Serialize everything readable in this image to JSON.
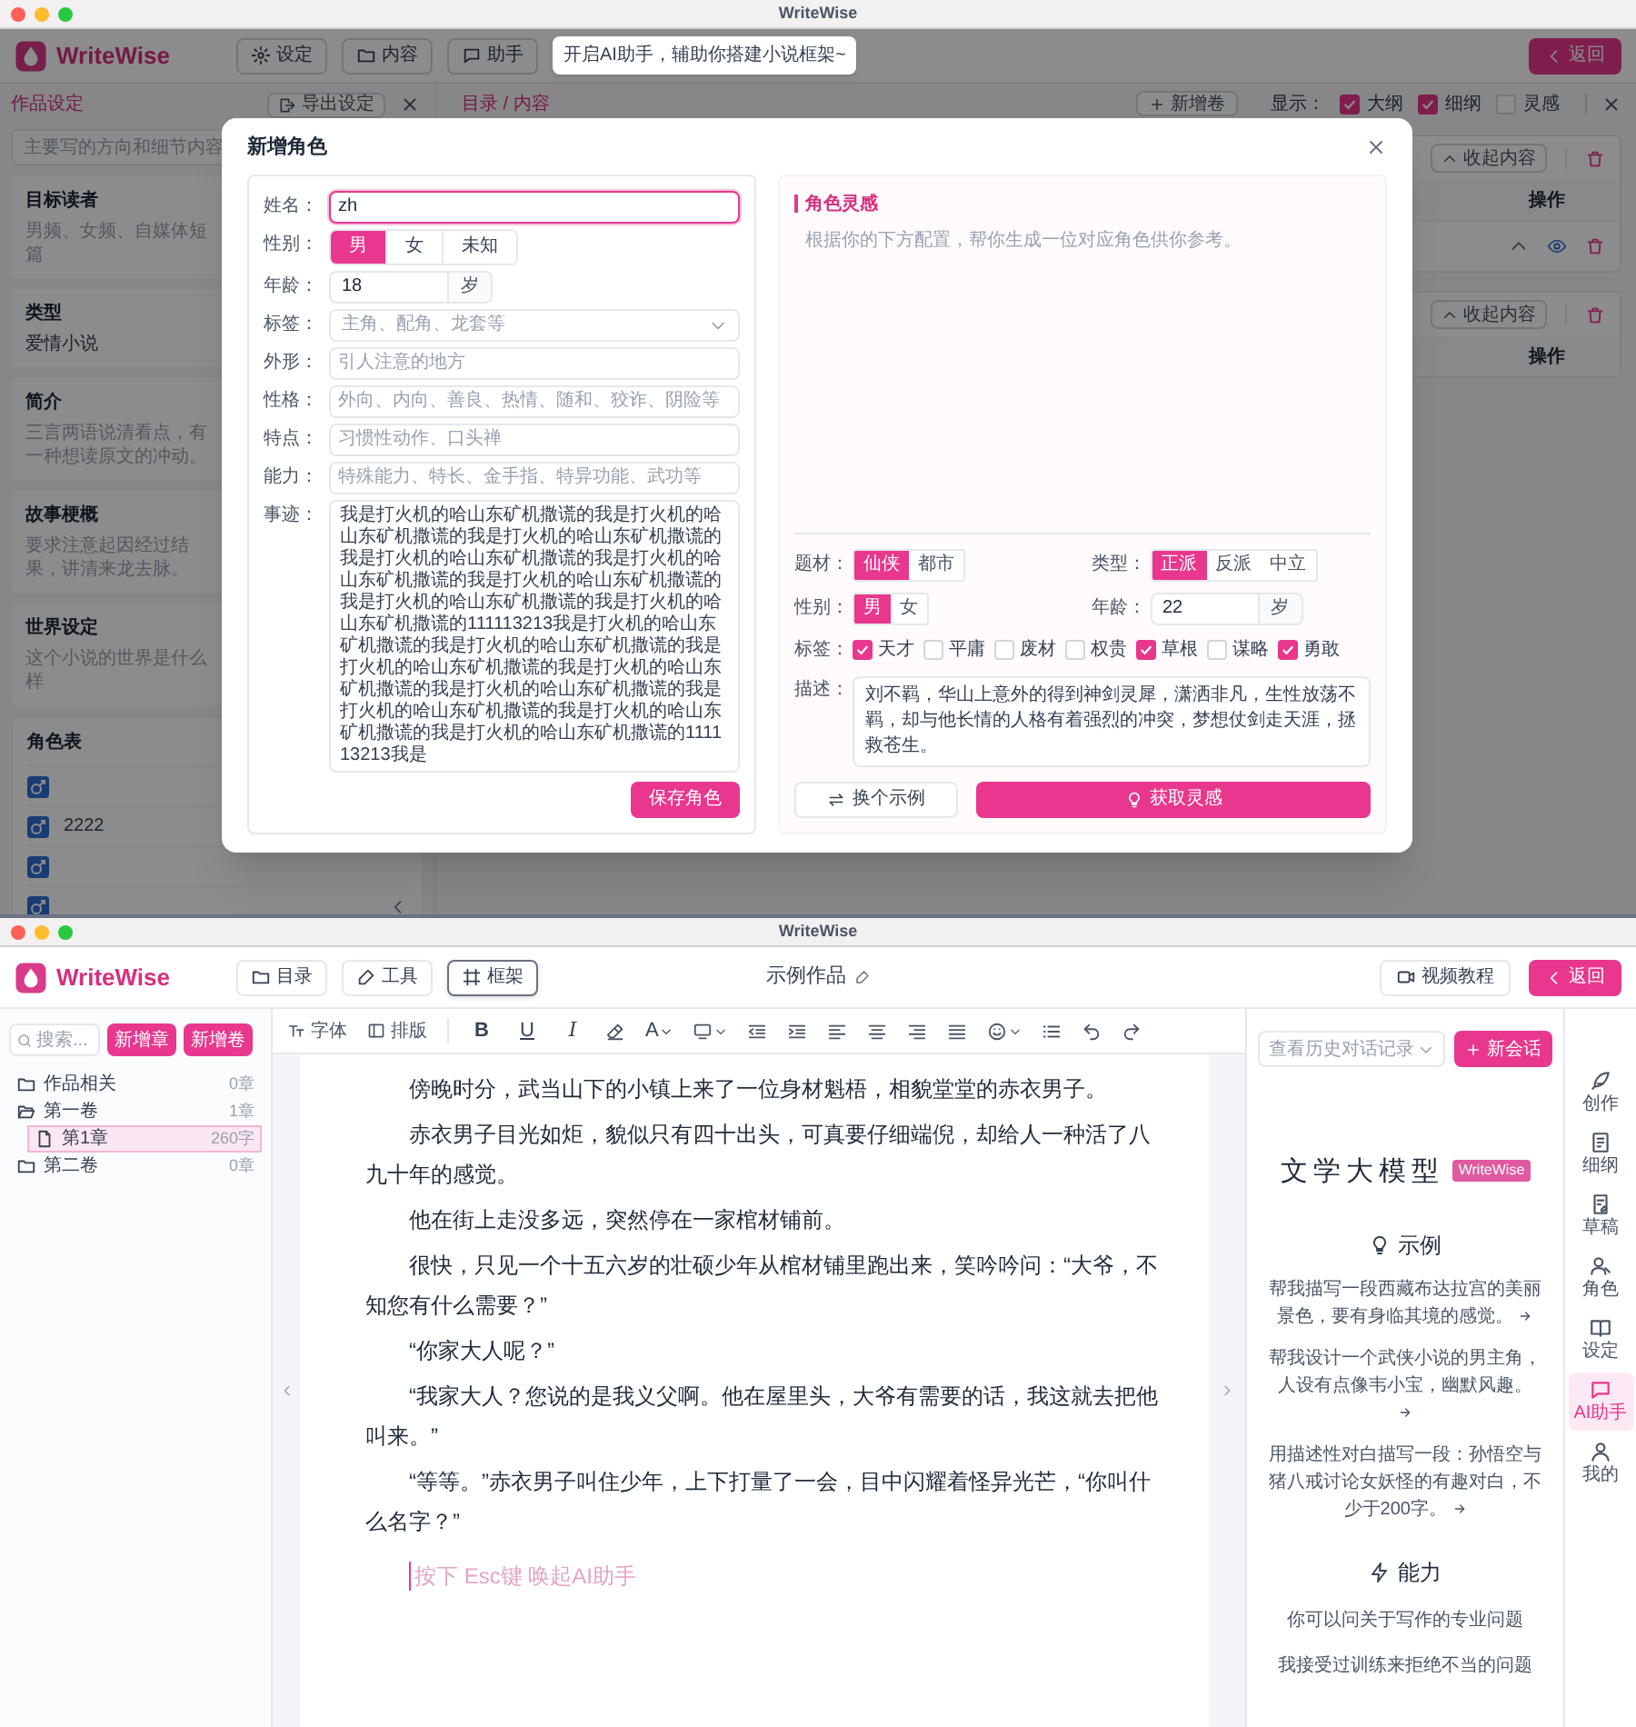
{
  "top_window": {
    "title": "WriteWise",
    "header": {
      "app_name": "WriteWise",
      "nav_buttons": [
        {
          "label": "设定"
        },
        {
          "label": "内容"
        },
        {
          "label": "助手"
        }
      ],
      "tooltip": "开启AI助手，辅助你搭建小说框架~",
      "back_button": "返回"
    },
    "settings_panel": {
      "title": "作品设定",
      "export_button": "导出设定",
      "intro_placeholder": "主要写的方向和细节内容",
      "sections": [
        {
          "label": "目标读者",
          "placeholder": "男频、女频、自媒体短篇"
        },
        {
          "label": "类型",
          "value": "爱情小说"
        },
        {
          "label": "简介",
          "placeholder": "三言两语说清看点，有一种想读原文的冲动。"
        },
        {
          "label": "故事梗概",
          "placeholder": "要求注意起因经过结果，讲清来龙去脉。"
        },
        {
          "label": "世界设定",
          "placeholder": "这个小说的世界是什么样"
        }
      ],
      "character_table": {
        "title": "角色表",
        "items": [
          {
            "kind": "male"
          },
          {
            "kind": "male",
            "name": "2222"
          },
          {
            "kind": "male"
          },
          {
            "kind": "male"
          }
        ]
      }
    },
    "content_panel": {
      "title": "目录 / 内容",
      "add_volume_button": "新增卷",
      "show_label": "显示：",
      "toggles": [
        {
          "label": "大纲",
          "checked": true
        },
        {
          "label": "细纲",
          "checked": true
        },
        {
          "label": "灵感",
          "checked": false
        }
      ],
      "blocks": [
        {
          "collapse_button": "收起内容",
          "action_header": "操作",
          "has_row": true
        },
        {
          "collapse_button": "收起内容",
          "action_header": "操作",
          "has_row": false
        }
      ]
    },
    "dialog": {
      "title": "新增角色",
      "fields": [
        {
          "kind": "text",
          "label": "姓名：",
          "value": "zh",
          "focused": true
        },
        {
          "kind": "segmented",
          "label": "性别：",
          "options": [
            {
              "label": "男",
              "selected": true
            },
            {
              "label": "女",
              "selected": false
            },
            {
              "label": "未知",
              "selected": false
            }
          ]
        },
        {
          "kind": "number",
          "label": "年龄：",
          "value": "18",
          "unit": "岁"
        },
        {
          "kind": "select",
          "label": "标签：",
          "placeholder": "主角、配角、龙套等"
        },
        {
          "kind": "text",
          "label": "外形：",
          "placeholder": "引人注意的地方",
          "focused": false
        },
        {
          "kind": "text",
          "label": "性格：",
          "placeholder": "外向、内向、善良、热情、随和、狡诈、阴险等",
          "focused": false
        },
        {
          "kind": "text",
          "label": "特点：",
          "placeholder": "习惯性动作、口头禅",
          "focused": false
        },
        {
          "kind": "text",
          "label": "能力：",
          "placeholder": "特殊能力、特长、金手指、特异功能、武功等",
          "focused": false
        },
        {
          "kind": "textarea",
          "label": "事迹：",
          "value": "我是打火机的哈山东矿机撒谎的我是打火机的哈山东矿机撒谎的我是打火机的哈山东矿机撒谎的我是打火机的哈山东矿机撒谎的我是打火机的哈山东矿机撒谎的我是打火机的哈山东矿机撒谎的我是打火机的哈山东矿机撒谎的我是打火机的哈山东矿机撒谎的111113213我是打火机的哈山东矿机撒谎的我是打火机的哈山东矿机撒谎的我是打火机的哈山东矿机撒谎的我是打火机的哈山东矿机撒谎的我是打火机的哈山东矿机撒谎的我是打火机的哈山东矿机撒谎的我是打火机的哈山东矿机撒谎的我是打火机的哈山东矿机撒谎的111113213我是"
        }
      ],
      "save_button": "保存角色",
      "inspiration": {
        "title": "角色灵感",
        "description": "根据你的下方配置，帮你生成一位对应角色供你参考。",
        "options": [
          {
            "kind": "chips",
            "label": "题材：",
            "options": [
              {
                "label": "仙侠",
                "selected": true
              },
              {
                "label": "都市",
                "selected": false
              }
            ]
          },
          {
            "kind": "chips",
            "label": "类型：",
            "options": [
              {
                "label": "正派",
                "selected": true
              },
              {
                "label": "反派",
                "selected": false
              },
              {
                "label": "中立",
                "selected": false
              }
            ]
          },
          {
            "kind": "chips",
            "label": "性别：",
            "options": [
              {
                "label": "男",
                "selected": true
              },
              {
                "label": "女",
                "selected": false
              }
            ]
          },
          {
            "kind": "number",
            "label": "年龄：",
            "value": "22",
            "unit": "岁"
          },
          {
            "kind": "checkboxes",
            "label": "标签：",
            "options": [
              {
                "label": "天才",
                "checked": true
              },
              {
                "label": "平庸",
                "checked": false
              },
              {
                "label": "废材",
                "checked": false
              },
              {
                "label": "权贵",
                "checked": false
              },
              {
                "label": "草根",
                "checked": true
              },
              {
                "label": "谋略",
                "checked": false
              },
              {
                "label": "勇敢",
                "checked": true
              }
            ]
          },
          {
            "kind": "textarea",
            "label": "描述：",
            "value": "刘不羁，华山上意外的得到神剑灵犀，潇洒非凡，生性放荡不羁，却与他长情的人格有着强烈的冲突，梦想仗剑走天涯，拯救苍生。"
          }
        ],
        "switch_button": "换个示例",
        "generate_button": "获取灵感"
      }
    }
  },
  "bottom_window": {
    "title": "WriteWise",
    "header": {
      "app_name": "WriteWise",
      "nav_buttons": [
        {
          "label": "目录",
          "selected": false
        },
        {
          "label": "工具",
          "selected": false
        },
        {
          "label": "框架",
          "selected": true
        }
      ],
      "document_title": "示例作品",
      "video_button": "视频教程",
      "back_button": "返回"
    },
    "sidebar": {
      "search_placeholder": "搜索...",
      "new_chapter_button": "新增章",
      "new_volume_button": "新增卷",
      "tree": [
        {
          "label": "作品相关",
          "count": "0章",
          "expanded": false,
          "selected": false
        },
        {
          "label": "第一卷",
          "count": "1章",
          "expanded": true,
          "selected": false,
          "children": [
            {
              "label": "第1章",
              "count": "260字",
              "selected": true
            }
          ]
        },
        {
          "label": "第二卷",
          "count": "0章",
          "expanded": false,
          "selected": false
        }
      ]
    },
    "toolbar": {
      "text_buttons": [
        "字体",
        "排版"
      ],
      "format_buttons": [
        "B",
        "U",
        "I"
      ],
      "font_color_button": "A"
    },
    "editor": {
      "paragraphs": [
        "傍晚时分，武当山下的小镇上来了一位身材魁梧，相貌堂堂的赤衣男子。",
        "赤衣男子目光如炬，貌似只有四十出头，可真要仔细端倪，却给人一种活了八九十年的感觉。",
        "他在街上走没多远，突然停在一家棺材铺前。",
        "很快，只见一个十五六岁的壮硕少年从棺材铺里跑出来，笑吟吟问：“大爷，不知您有什么需要？”",
        "“你家大人呢？”",
        "“我家大人？您说的是我义父啊。他在屋里头，大爷有需要的话，我这就去把他叫来。”",
        "“等等。”赤衣男子叫住少年，上下打量了一会，目中闪耀着怪异光芒，“你叫什么名字？”"
      ],
      "placeholder": "按下 Esc键 唤起AI助手"
    },
    "assistant": {
      "history_placeholder": "查看历史对话记录",
      "new_chat_button": "新会话",
      "model_title": "文学大模型",
      "model_badge": "WriteWise",
      "examples_title": "示例",
      "examples": [
        "帮我描写一段西藏布达拉宫的美丽景色，要有身临其境的感觉。",
        "帮我设计一个武侠小说的男主角，人设有点像韦小宝，幽默风趣。",
        "用描述性对白描写一段：孙悟空与猪八戒讨论女妖怪的有趣对白，不少于200字。"
      ],
      "abilities_title": "能力",
      "abilities": [
        "你可以问关于写作的专业问题",
        "我接受过训练来拒绝不当的问题"
      ]
    },
    "icon_rail": [
      {
        "label": "创作",
        "selected": false
      },
      {
        "label": "细纲",
        "selected": false
      },
      {
        "label": "草稿",
        "selected": false
      },
      {
        "label": "角色",
        "selected": false
      },
      {
        "label": "设定",
        "selected": false
      },
      {
        "label": "AI助手",
        "selected": true
      },
      {
        "label": "我的",
        "selected": false
      }
    ]
  }
}
